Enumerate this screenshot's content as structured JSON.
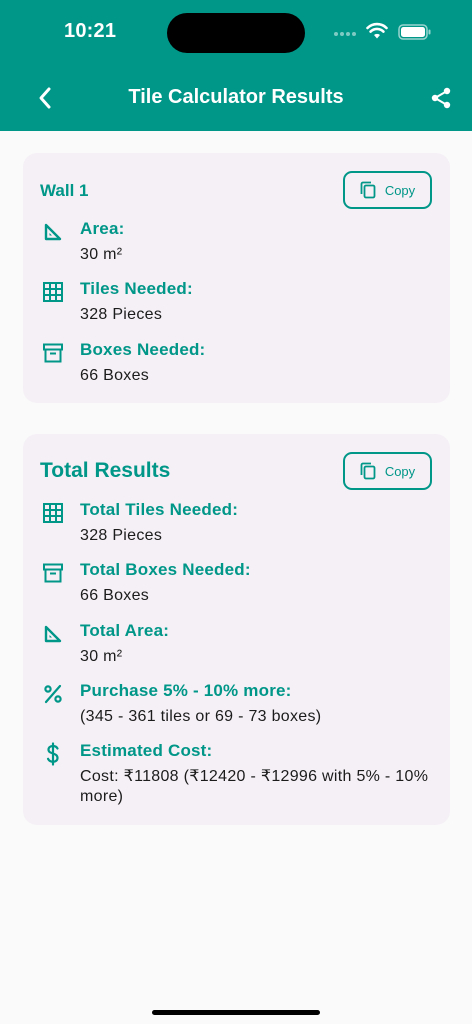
{
  "status_bar": {
    "time": "10:21"
  },
  "app_bar": {
    "title": "Tile Calculator Results"
  },
  "wall_card": {
    "title": "Wall 1",
    "copy_label": "Copy",
    "area_label": "Area:",
    "area_value": "30 m²",
    "tiles_label": "Tiles Needed:",
    "tiles_value": "328 Pieces",
    "boxes_label": "Boxes Needed:",
    "boxes_value": "66 Boxes"
  },
  "total_card": {
    "title": "Total Results",
    "copy_label": "Copy",
    "tiles_label": "Total Tiles Needed:",
    "tiles_value": "328 Pieces",
    "boxes_label": "Total Boxes Needed:",
    "boxes_value": "66 Boxes",
    "area_label": "Total Area:",
    "area_value": "30 m²",
    "purchase_label": "Purchase 5% - 10% more:",
    "purchase_value": "(345 - 361 tiles or 69 - 73 boxes)",
    "cost_label": "Estimated Cost:",
    "cost_value": "Cost: ₹11808 (₹12420 - ₹12996 with 5% - 10% more)"
  },
  "icons": {
    "back": "chevron-left-icon",
    "share": "share-icon",
    "copy": "copy-icon",
    "area": "set-square-icon",
    "tiles": "grid-icon",
    "boxes": "archive-box-icon",
    "percent": "percent-icon",
    "cost": "dollar-icon"
  },
  "colors": {
    "primary": "#009688",
    "card_bg": "#f5f0f6",
    "page_bg": "#fafafa"
  }
}
